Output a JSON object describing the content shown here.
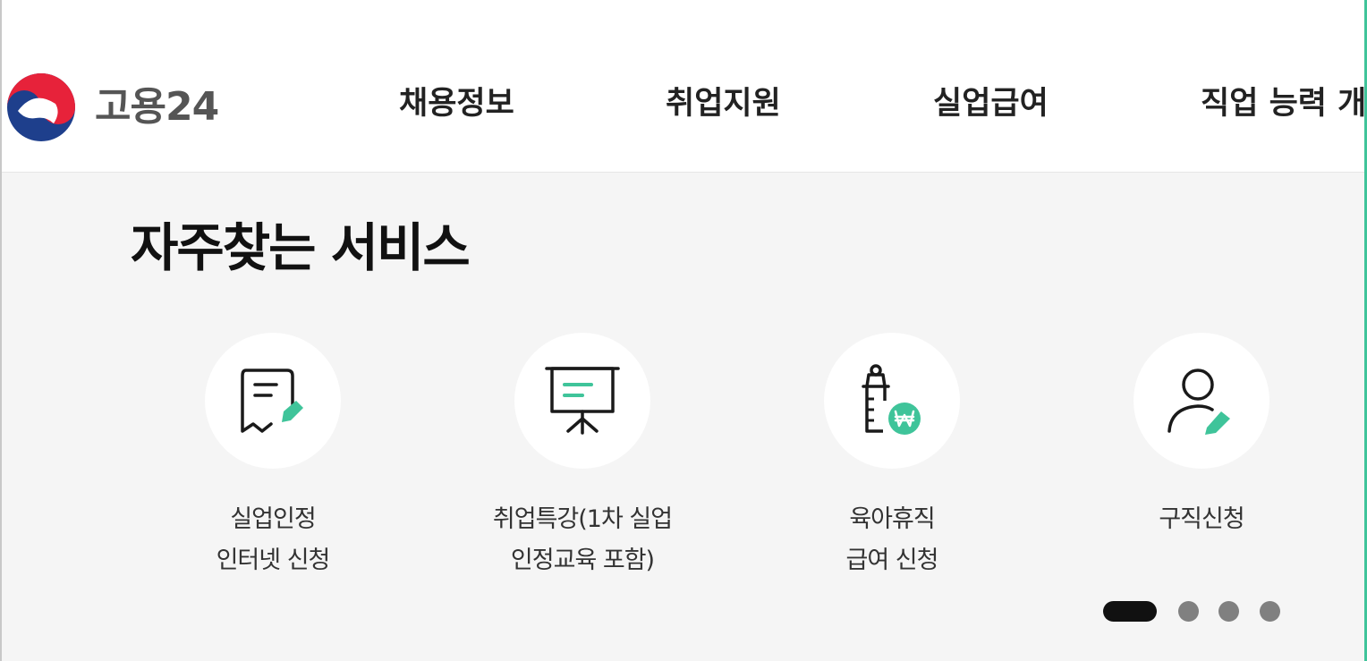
{
  "header": {
    "logo_text": "고용24",
    "nav": [
      "채용정보",
      "취업지원",
      "실업급여",
      "직업 능력 개"
    ]
  },
  "main": {
    "title": "자주찾는 서비스",
    "services": [
      {
        "icon": "document-edit-icon",
        "line1": "실업인정",
        "line2": "인터넷 신청"
      },
      {
        "icon": "presentation-board-icon",
        "line1": "취업특강(1차 실업",
        "line2": "인정교육 포함)"
      },
      {
        "icon": "baby-bottle-won-icon",
        "line1": "육아휴직",
        "line2": "급여 신청"
      },
      {
        "icon": "user-edit-icon",
        "line1": "구직신청",
        "line2": ""
      }
    ],
    "pagination": {
      "pages": 4,
      "current": 1
    }
  },
  "colors": {
    "accent": "#3fc49a",
    "logo_red": "#e7223a",
    "logo_blue": "#1e3f8c",
    "active_dot": "#111111",
    "inactive_dot": "#808080"
  }
}
